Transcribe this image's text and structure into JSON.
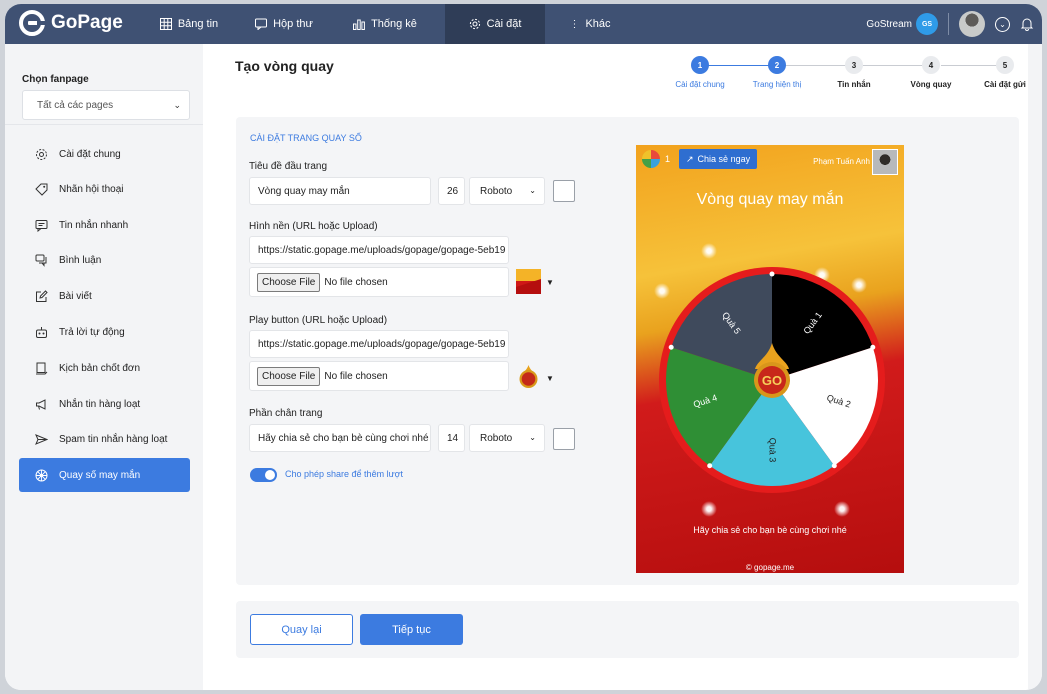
{
  "app": {
    "name": "GoPage"
  },
  "nav": {
    "items": [
      {
        "label": "Bảng tin",
        "icon": "grid-icon"
      },
      {
        "label": "Hộp thư",
        "icon": "chat-icon"
      },
      {
        "label": "Thống kê",
        "icon": "chart-icon"
      },
      {
        "label": "Cài đặt",
        "icon": "gear-icon",
        "active": true
      },
      {
        "label": "Khác",
        "icon": "more-vertical-icon"
      }
    ],
    "gostream_label": "GoStream",
    "gostream_badge": "GS"
  },
  "sidebar": {
    "fanpage_label": "Chọn fanpage",
    "fanpage_select": "Tất cả các pages",
    "items": [
      {
        "label": "Cài đặt chung",
        "icon": "gear-icon"
      },
      {
        "label": "Nhãn hội thoại",
        "icon": "tag-icon"
      },
      {
        "label": "Tin nhắn nhanh",
        "icon": "message-icon"
      },
      {
        "label": "Bình luận",
        "icon": "comments-icon"
      },
      {
        "label": "Bài viết",
        "icon": "edit-icon"
      },
      {
        "label": "Trả lời tự động",
        "icon": "robot-icon"
      },
      {
        "label": "Kịch bản chốt đơn",
        "icon": "script-icon"
      },
      {
        "label": "Nhắn tin hàng loạt",
        "icon": "megaphone-icon"
      },
      {
        "label": "Spam tin nhắn hàng loạt",
        "icon": "send-icon"
      },
      {
        "label": "Quay số may mắn",
        "icon": "wheel-icon",
        "active": true
      }
    ]
  },
  "page": {
    "title": "Tạo vòng quay"
  },
  "stepper": [
    {
      "num": "1",
      "label": "Cài đặt chung",
      "done": true
    },
    {
      "num": "2",
      "label": "Trang hiện thị",
      "done": true
    },
    {
      "num": "3",
      "label": "Tin nhắn",
      "done": false
    },
    {
      "num": "4",
      "label": "Vòng quay",
      "done": false
    },
    {
      "num": "5",
      "label": "Cài đặt gửi",
      "done": false
    }
  ],
  "form": {
    "section_title": "CÀI ĐẶT TRANG QUAY SỐ",
    "title_label": "Tiêu đề đầu trang",
    "title_value": "Vòng quay may mắn",
    "title_size": "26",
    "title_font": "Roboto",
    "bg_label": "Hình nền (URL hoặc Upload)",
    "bg_url": "https://static.gopage.me/uploads/gopage/gopage-5eb19",
    "choose_file": "Choose File",
    "no_file": "No file chosen",
    "play_label": "Play button (URL hoặc Upload)",
    "play_url": "https://static.gopage.me/uploads/gopage/gopage-5eb19",
    "footer_label": "Phần chân trang",
    "footer_value": "Hãy chia sẻ cho bạn bè cùng chơi nhé",
    "footer_size": "14",
    "footer_font": "Roboto",
    "share_toggle_label": "Cho phép share để thêm lượt",
    "share_toggle_on": true
  },
  "preview": {
    "count": "1",
    "share_button": "Chia sẻ ngay",
    "user_name": "Phạm Tuấn Anh",
    "title": "Vòng quay may mắn",
    "segments": [
      "Quà 1",
      "Quà 2",
      "Quà 3",
      "Quà 4",
      "Quà 5"
    ],
    "segment_colors": [
      "#000000",
      "#ffffff",
      "#47c4dc",
      "#2f8f35",
      "#3f4a5c"
    ],
    "go_label": "GO",
    "footer": "Hãy chia sẻ cho bạn bè cùng chơi nhé",
    "copyright": "© gopage.me"
  },
  "actions": {
    "back": "Quay lại",
    "next": "Tiếp tục"
  },
  "colors": {
    "nav": "#3f5173",
    "accent": "#3c7be0",
    "sidebar": "#f3f4f6"
  }
}
